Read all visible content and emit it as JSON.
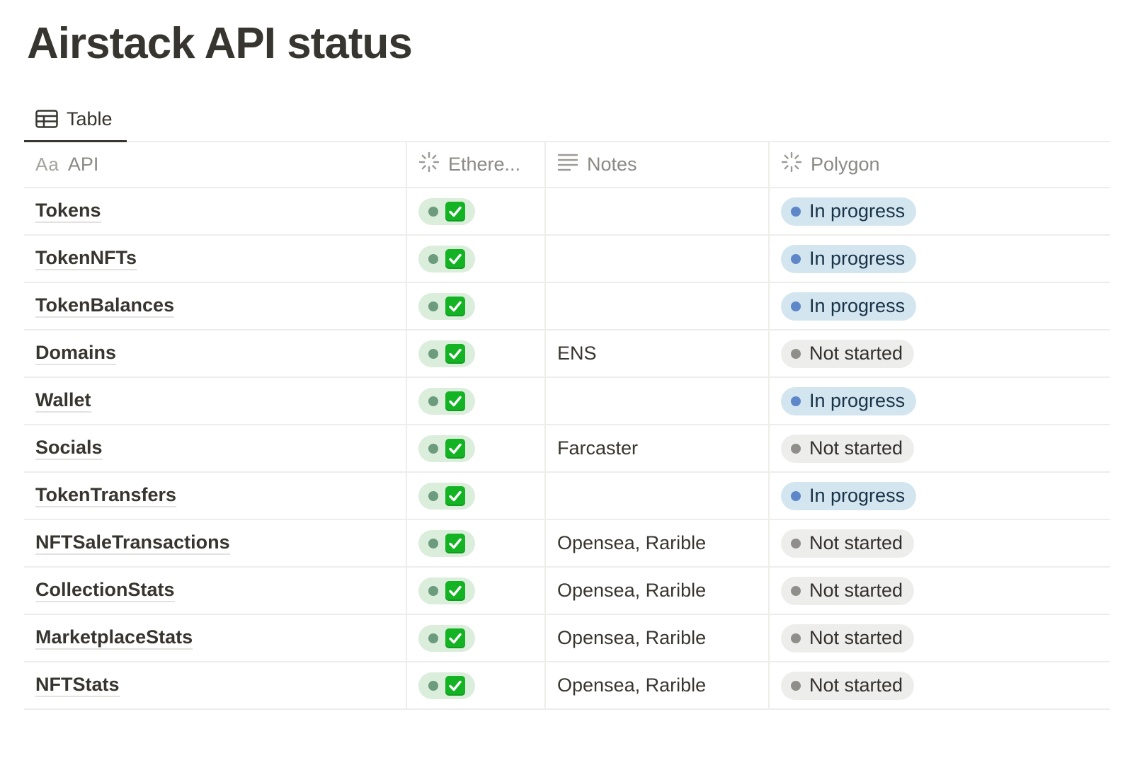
{
  "page": {
    "title": "Airstack API status"
  },
  "view": {
    "tab_label": "Table",
    "tab_icon": "table-icon"
  },
  "columns": {
    "api": {
      "label": "API",
      "icon_text": "Aa"
    },
    "ethereum": {
      "label": "Ethere...",
      "icon": "status-spinner-icon"
    },
    "notes": {
      "label": "Notes",
      "icon": "text-lines-icon"
    },
    "polygon": {
      "label": "Polygon",
      "icon": "status-spinner-icon"
    }
  },
  "colors": {
    "eth_pill_bg": "#dbeddb",
    "check_green": "#13b324",
    "in_progress_bg": "#d3e5ef",
    "in_progress_dot": "#5e87c9",
    "not_started_bg": "#ededec",
    "not_started_dot": "#8f8e8a"
  },
  "rows": [
    {
      "api": "Tokens",
      "eth_icon": "check-mark-icon",
      "notes": "",
      "polygon": "In progress",
      "polygon_variant": "blue"
    },
    {
      "api": "TokenNFTs",
      "eth_icon": "check-mark-icon",
      "notes": "",
      "polygon": "In progress",
      "polygon_variant": "blue"
    },
    {
      "api": "TokenBalances",
      "eth_icon": "check-mark-icon",
      "notes": "",
      "polygon": "In progress",
      "polygon_variant": "blue"
    },
    {
      "api": "Domains",
      "eth_icon": "check-mark-icon",
      "notes": "ENS",
      "polygon": "Not started",
      "polygon_variant": "gray"
    },
    {
      "api": "Wallet",
      "eth_icon": "check-mark-icon",
      "notes": "",
      "polygon": "In progress",
      "polygon_variant": "blue"
    },
    {
      "api": "Socials",
      "eth_icon": "check-mark-icon",
      "notes": "Farcaster",
      "polygon": "Not started",
      "polygon_variant": "gray"
    },
    {
      "api": "TokenTransfers",
      "eth_icon": "check-mark-icon",
      "notes": "",
      "polygon": "In progress",
      "polygon_variant": "blue"
    },
    {
      "api": "NFTSaleTransactions",
      "eth_icon": "check-mark-icon",
      "notes": "Opensea, Rarible",
      "polygon": "Not started",
      "polygon_variant": "gray"
    },
    {
      "api": "CollectionStats",
      "eth_icon": "check-mark-icon",
      "notes": "Opensea, Rarible",
      "polygon": "Not started",
      "polygon_variant": "gray"
    },
    {
      "api": "MarketplaceStats",
      "eth_icon": "check-mark-icon",
      "notes": "Opensea, Rarible",
      "polygon": "Not started",
      "polygon_variant": "gray"
    },
    {
      "api": "NFTStats",
      "eth_icon": "check-mark-icon",
      "notes": "Opensea, Rarible",
      "polygon": "Not started",
      "polygon_variant": "gray"
    }
  ]
}
